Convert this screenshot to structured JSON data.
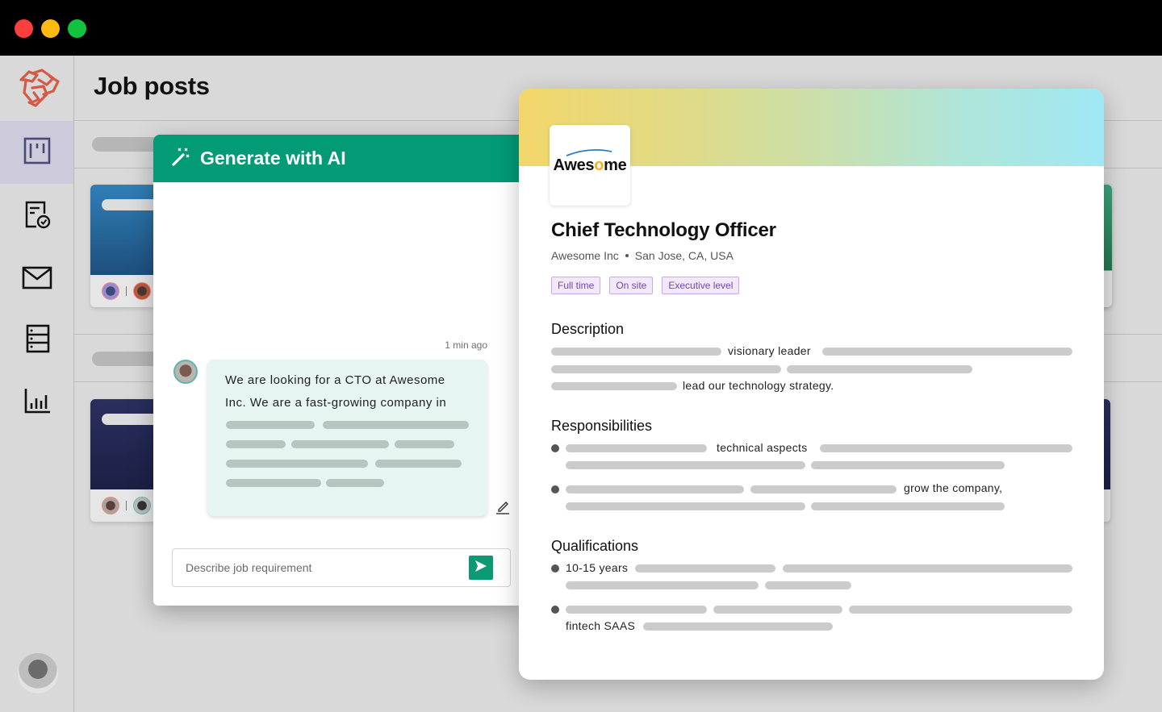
{
  "window": {
    "controls": [
      "close",
      "minimize",
      "maximize"
    ]
  },
  "sidebar": {
    "logo_icon": "brand-knot-logo",
    "items": [
      {
        "name": "job-board",
        "icon": "kanban-board-icon",
        "active": true
      },
      {
        "name": "document-check",
        "icon": "document-check-icon",
        "active": false
      },
      {
        "name": "mail",
        "icon": "mail-icon",
        "active": false
      },
      {
        "name": "database",
        "icon": "server-list-icon",
        "active": false
      },
      {
        "name": "analytics",
        "icon": "bar-chart-icon",
        "active": false
      }
    ],
    "user_avatar": "user-avatar"
  },
  "main": {
    "title": "Job posts"
  },
  "ai_panel": {
    "title": "Generate with AI",
    "icon": "magic-wand-icon",
    "timestamp": "1 min ago",
    "message": "We are looking for a CTO at Awesome Inc. We are a fast-growing company in",
    "input_placeholder": "Describe job requirement",
    "input_value": "",
    "send_icon": "send-icon",
    "edit_icon": "edit-pencil-icon",
    "accent_color": "#039a76"
  },
  "job_detail": {
    "company_logo_text_pre": "Awes",
    "company_logo_text_o": "o",
    "company_logo_text_post": "me",
    "title": "Chief Technology Officer",
    "company": "Awesome Inc",
    "location": "San Jose, CA, USA",
    "tags": [
      "Full time",
      "On site",
      "Executive level"
    ],
    "sections": {
      "description": {
        "title": "Description",
        "fragments": [
          "visionary leader",
          "lead our technology strategy."
        ]
      },
      "responsibilities": {
        "title": "Responsibilities",
        "fragments": [
          "technical aspects",
          "grow the company,"
        ]
      },
      "qualifications": {
        "title": "Qualifications",
        "fragments": [
          "10-15 years",
          "fintech SAAS"
        ]
      }
    }
  }
}
